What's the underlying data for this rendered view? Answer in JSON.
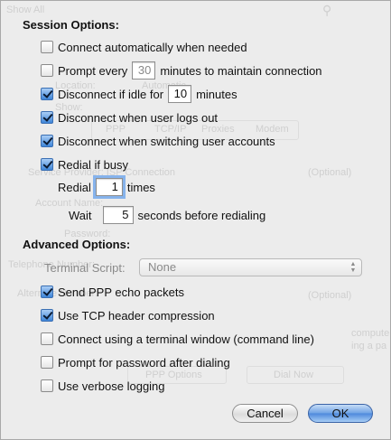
{
  "background_window": {
    "search_text": "Show All",
    "location_label": "Location:",
    "location_value": "Automatic",
    "show_label": "Show:",
    "tabs": [
      "PPP",
      "TCP/IP",
      "Proxies",
      "Modem"
    ],
    "service_provider": "Service Provider: ISP Connection",
    "service_optional": "(Optional)",
    "account_name": "Account Name:",
    "password": "Password:",
    "telephone": "Telephone Number:",
    "alternate": "Alternate Number:",
    "alternate_optional": "(Optional)",
    "hint_1": "computer",
    "hint_2": "ing a pa",
    "ppp_options": "PPP Options",
    "dial_now": "Dial Now"
  },
  "session": {
    "title": "Session Options:",
    "connect_auto": {
      "label": "Connect automatically when needed",
      "checked": false
    },
    "prompt_every": {
      "label_before": "Prompt every",
      "value": "30",
      "label_after": "minutes to maintain connection",
      "checked": false
    },
    "disconnect_idle": {
      "label_before": "Disconnect if idle for",
      "value": "10",
      "label_after": "minutes",
      "checked": true
    },
    "disconnect_logout": {
      "label": "Disconnect when user logs out",
      "checked": true
    },
    "disconnect_switch": {
      "label": "Disconnect when switching user accounts",
      "checked": true
    },
    "redial_busy": {
      "label": "Redial if busy",
      "checked": true
    },
    "redial_count": {
      "label_before": "Redial",
      "value": "1",
      "label_after": "times"
    },
    "wait": {
      "label_before": "Wait",
      "value": "5",
      "label_after": "seconds before redialing"
    }
  },
  "advanced": {
    "title": "Advanced Options:",
    "terminal_script": {
      "label": "Terminal Script:",
      "value": "None"
    },
    "echo_packets": {
      "label": "Send PPP echo packets",
      "checked": true
    },
    "tcp_compression": {
      "label": "Use TCP header compression",
      "checked": true
    },
    "terminal_window": {
      "label": "Connect using a terminal window (command line)",
      "checked": false
    },
    "prompt_password": {
      "label": "Prompt for password after dialing",
      "checked": false
    },
    "verbose_logging": {
      "label": "Use verbose logging",
      "checked": false
    }
  },
  "buttons": {
    "cancel": "Cancel",
    "ok": "OK"
  },
  "colors": {
    "accent": "#4c88dc",
    "focus_ring": "#86b3ec",
    "sheet_bg": "#ececec"
  }
}
